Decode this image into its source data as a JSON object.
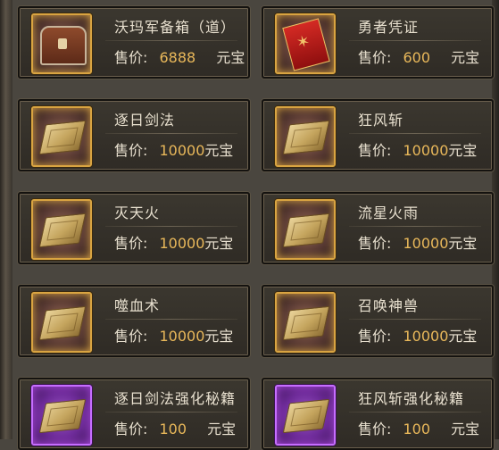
{
  "items": [
    {
      "name": "沃玛军备箱（道）",
      "price_label": "售价:",
      "price": "6888",
      "currency": "元宝",
      "icon": "treasure-chest-icon",
      "rarity": "gold"
    },
    {
      "name": "勇者凭证",
      "price_label": "售价:",
      "price": "600",
      "currency": "元宝",
      "icon": "red-token-icon",
      "rarity": "gold"
    },
    {
      "name": "逐日剑法",
      "price_label": "售价:",
      "price": "10000",
      "currency": "元宝",
      "icon": "skill-book-icon",
      "rarity": "gold"
    },
    {
      "name": "狂风斩",
      "price_label": "售价:",
      "price": "10000",
      "currency": "元宝",
      "icon": "skill-book-icon",
      "rarity": "gold"
    },
    {
      "name": "灭天火",
      "price_label": "售价:",
      "price": "10000",
      "currency": "元宝",
      "icon": "skill-book-icon",
      "rarity": "gold"
    },
    {
      "name": "流星火雨",
      "price_label": "售价:",
      "price": "10000",
      "currency": "元宝",
      "icon": "skill-book-icon",
      "rarity": "gold"
    },
    {
      "name": "噬血术",
      "price_label": "售价:",
      "price": "10000",
      "currency": "元宝",
      "icon": "skill-book-icon",
      "rarity": "gold"
    },
    {
      "name": "召唤神兽",
      "price_label": "售价:",
      "price": "10000",
      "currency": "元宝",
      "icon": "skill-book-icon",
      "rarity": "gold"
    },
    {
      "name": "逐日剑法强化秘籍",
      "price_label": "售价:",
      "price": "100",
      "currency": "元宝",
      "icon": "skill-book-icon",
      "rarity": "purple"
    },
    {
      "name": "狂风斩强化秘籍",
      "price_label": "售价:",
      "price": "100",
      "currency": "元宝",
      "icon": "skill-book-icon",
      "rarity": "purple"
    }
  ],
  "colors": {
    "price": "#e9b85a",
    "gold_border": "#d9a441",
    "purple_border": "#c66dff"
  }
}
